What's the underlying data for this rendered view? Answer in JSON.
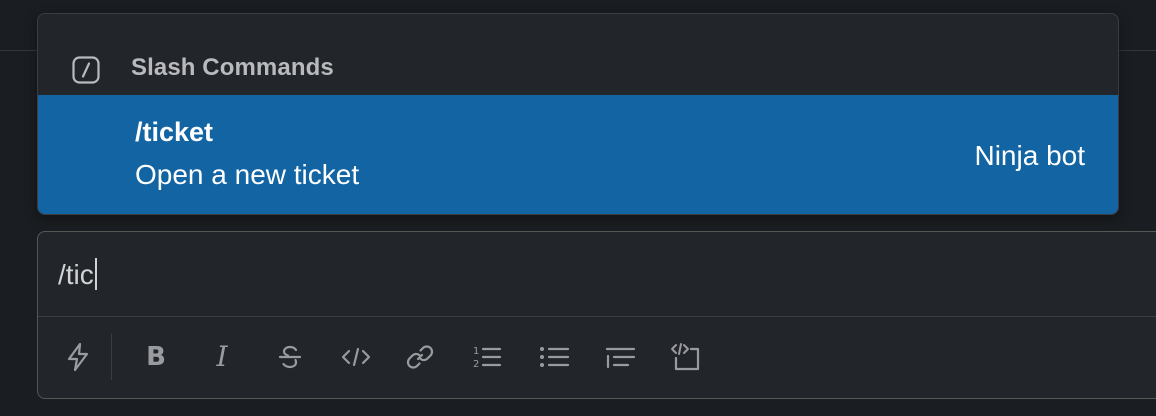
{
  "popup": {
    "header_title": "Slash Commands",
    "header_icon": "slash-command-icon",
    "items": [
      {
        "command": "/ticket",
        "description": "Open a new ticket",
        "app": "Ninja bot",
        "selected": true
      }
    ]
  },
  "composer": {
    "value": "/tic",
    "toolbar": [
      {
        "name": "shortcuts-lightning-icon",
        "label": "Shortcuts"
      },
      {
        "name": "bold-icon",
        "label": "B"
      },
      {
        "name": "italic-icon",
        "label": "I"
      },
      {
        "name": "strikethrough-icon",
        "label": "Strikethrough"
      },
      {
        "name": "code-icon",
        "label": "Code"
      },
      {
        "name": "link-icon",
        "label": "Link"
      },
      {
        "name": "ordered-list-icon",
        "label": "Ordered list"
      },
      {
        "name": "bulleted-list-icon",
        "label": "Bulleted list"
      },
      {
        "name": "blockquote-icon",
        "label": "Blockquote"
      },
      {
        "name": "code-block-icon",
        "label": "Code block"
      }
    ]
  },
  "colors": {
    "background": "#1a1d21",
    "popup_bg": "#222529",
    "selected_bg": "#1264a3",
    "icon_gray": "#9a9b9e"
  }
}
